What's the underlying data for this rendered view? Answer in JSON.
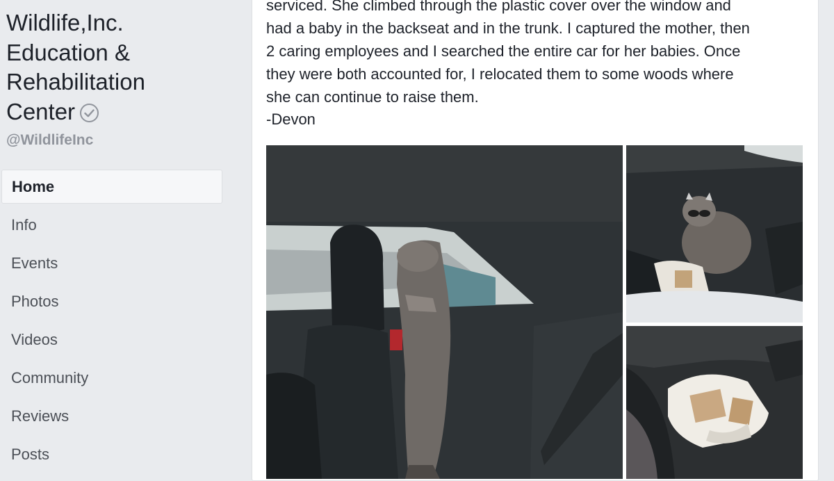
{
  "sidebar": {
    "page_name_lines": [
      "Wildlife,Inc.",
      "Education &",
      "Rehabilitation",
      "Center"
    ],
    "handle": "@WildlifeInc",
    "nav_items": [
      {
        "label": "Home",
        "active": true
      },
      {
        "label": "Info"
      },
      {
        "label": "Events"
      },
      {
        "label": "Photos"
      },
      {
        "label": "Videos"
      },
      {
        "label": "Community"
      },
      {
        "label": "Reviews"
      },
      {
        "label": "Posts"
      }
    ]
  },
  "post": {
    "text_lines": [
      "serviced. She climbed through the plastic cover over the window and",
      "had a baby in the backseat and in the trunk. I captured the mother, then",
      "2 caring employees and I searched the entire car for her babies. Once",
      "they were both accounted for, I relocated them to some woods where",
      "she can continue to raise them."
    ],
    "signature": "-Devon",
    "photos": [
      {
        "name": "raccoon-at-car-window-photo"
      },
      {
        "name": "raccoon-in-back-seat-photo"
      },
      {
        "name": "torn-box-on-seat-photo"
      }
    ]
  },
  "colors": {
    "background": "#e9ebee",
    "card": "#ffffff",
    "text": "#1d2129",
    "muted": "#90949c"
  }
}
